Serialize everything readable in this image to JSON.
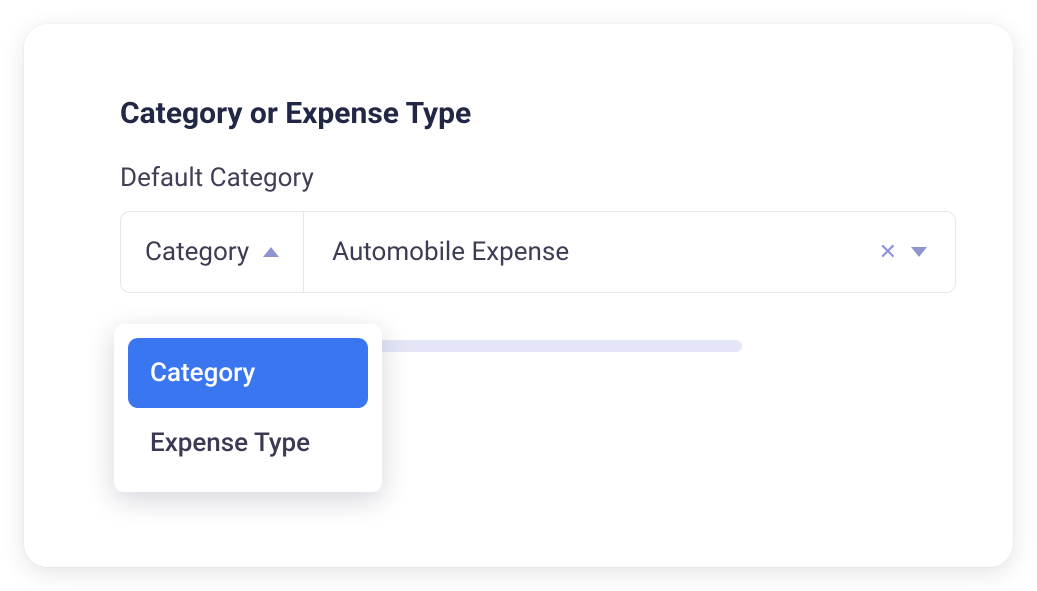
{
  "section_title": "Category or Expense Type",
  "field_label": "Default Category",
  "type_selector": {
    "label": "Category",
    "options": [
      "Category",
      "Expense Type"
    ],
    "selected_index": 0
  },
  "value_selector": {
    "selected": "Automobile Expense"
  }
}
